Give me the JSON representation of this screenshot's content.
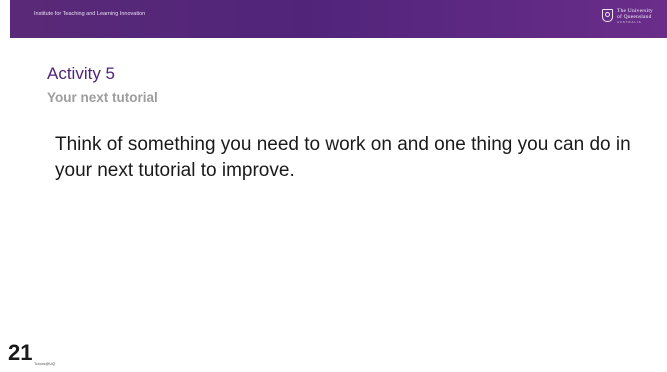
{
  "header": {
    "org_name": "Institute for Teaching and Learning Innovation",
    "logo": {
      "icon": "uq-crest-icon",
      "line1": "The University",
      "line2": "of Queensland",
      "country": "AUSTRALIA"
    }
  },
  "slide": {
    "title": "Activity 5",
    "subtitle": "Your next tutorial",
    "body": "Think of something you need to work on and one thing you can do in your next tutorial to improve.",
    "number": "21",
    "footer_brand": "Tutors@UQ"
  },
  "colors": {
    "brand_purple": "#51247a",
    "subtitle_grey": "#9d9d9d",
    "text": "#1a1a1a"
  }
}
